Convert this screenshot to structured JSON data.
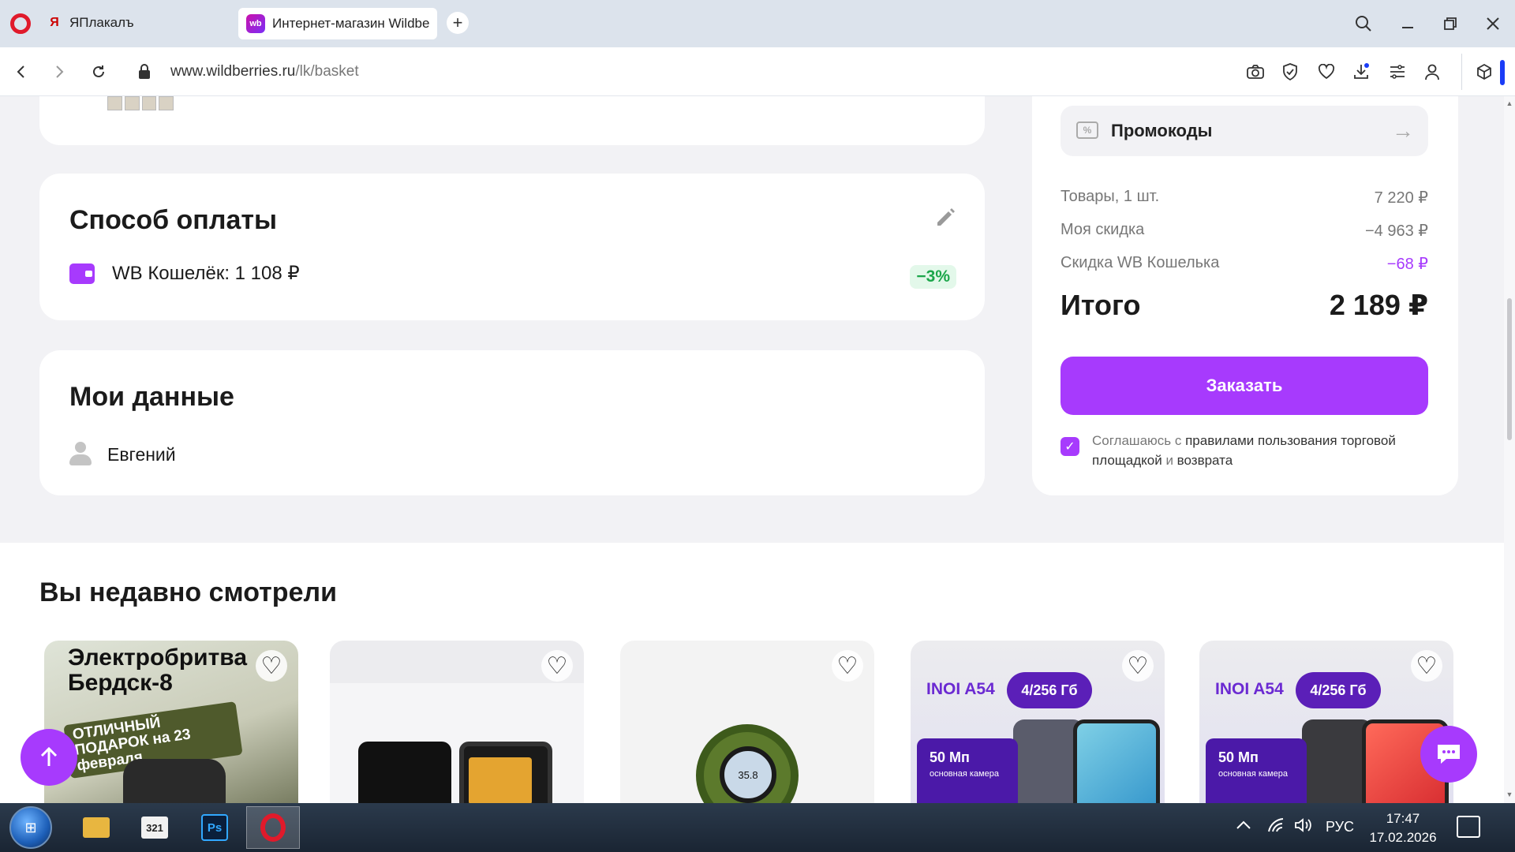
{
  "browser": {
    "tabs": [
      {
        "label": "ЯПлакалъ",
        "icon": "yaplakal-icon"
      },
      {
        "label": "Интернет-магазин Wildberries",
        "icon": "wildberries-icon",
        "favicon_text": "wb"
      }
    ],
    "url_domain": "www.wildberries.ru",
    "url_path": "/lk/basket"
  },
  "payment": {
    "title": "Способ оплаты",
    "method": "WB Кошелёк: 1 108 ₽",
    "discount": "−3%"
  },
  "mydata": {
    "title": "Мои данные",
    "name": "Евгений"
  },
  "summary": {
    "promo_label": "Промокоды",
    "rows": [
      {
        "label": "Товары, 1 шт.",
        "value": "7 220 ₽"
      },
      {
        "label": "Моя скидка",
        "value": "−4 963 ₽"
      },
      {
        "label": "Скидка WB Кошелька",
        "value": "−68 ₽"
      }
    ],
    "total_label": "Итого",
    "total_value": "2 189 ₽",
    "order_button": "Заказать",
    "agree_pre": "Соглашаюсь с ",
    "agree_link1": "правилами пользования торговой площадкой",
    "agree_mid": " и ",
    "agree_link2": "возврата"
  },
  "recent": {
    "title": "Вы недавно смотрели",
    "items": [
      {
        "headline": "Электробритва Бердск-8",
        "ribbon": "ОТЛИЧНЫЙ ПОДАРОК на 23 февраля"
      },
      {},
      {
        "screen_text": "35.8"
      },
      {
        "brand": "INOI A54",
        "badge": "4/256 Гб",
        "cam_big": "50 Мп",
        "cam_small": "основная камера"
      },
      {
        "brand": "INOI A54",
        "badge": "4/256 Гб",
        "cam_big": "50 Мп",
        "cam_small": "основная камера"
      }
    ]
  },
  "taskbar": {
    "lang": "РУС",
    "time": "17:47",
    "date": "17.02.2026",
    "mpc_label": "321",
    "ps_label": "Ps"
  },
  "colors": {
    "accent": "#a73afd",
    "discount_green": "#1ba64a",
    "page_bg": "#f2f2f5"
  }
}
